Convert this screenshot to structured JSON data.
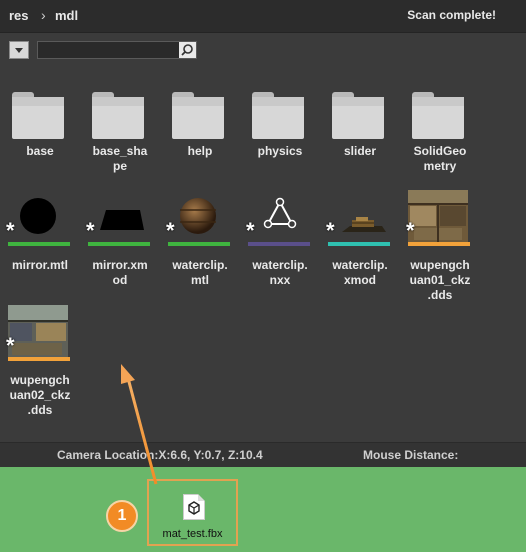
{
  "breadcrumb": {
    "root": "res",
    "separator": "›",
    "current": "mdl"
  },
  "status_text": "Scan complete!",
  "search": {
    "value": "",
    "placeholder": ""
  },
  "folders": [
    {
      "label": "base"
    },
    {
      "label": "base_sha\npe"
    },
    {
      "label": "help"
    },
    {
      "label": "physics"
    },
    {
      "label": "slider"
    },
    {
      "label": "SolidGeo\nmetry"
    }
  ],
  "files": [
    {
      "label": "mirror.mtl",
      "icon": "black-sphere-icon",
      "color": "#3fb43f"
    },
    {
      "label": "mirror.xm\nod",
      "icon": "black-slab-icon",
      "color": "#3fb43f"
    },
    {
      "label": "waterclip.\nmtl",
      "icon": "barrel-sphere-icon",
      "color": "#3fb43f"
    },
    {
      "label": "waterclip.\nnxx",
      "icon": "triangle-nodes-icon",
      "color": "#5a4f8a"
    },
    {
      "label": "waterclip.\nxmod",
      "icon": "boat-model-icon",
      "color": "#2fc0b0"
    },
    {
      "label": "wupengch\nuan01_ckz\n.dds",
      "icon": "texture-thumbnail-icon",
      "color": "#f2a23a"
    },
    {
      "label": "wupengch\nuan02_ckz\n.dds",
      "icon": "texture-thumbnail-icon",
      "color": "#f2a23a"
    }
  ],
  "star_symbol": "*",
  "camera_location": "Camera Location:X:6.6, Y:0.7, Z:10.4",
  "mouse_distance": "Mouse Distance:",
  "dragged_file": {
    "label": "mat_test.fbx",
    "icon": "3d-cube-file-icon"
  },
  "step_badge": "1",
  "colors": {
    "accent_orange": "#f28b25",
    "drop_zone": "#6ab76a",
    "panel": "#3b3b3b"
  }
}
